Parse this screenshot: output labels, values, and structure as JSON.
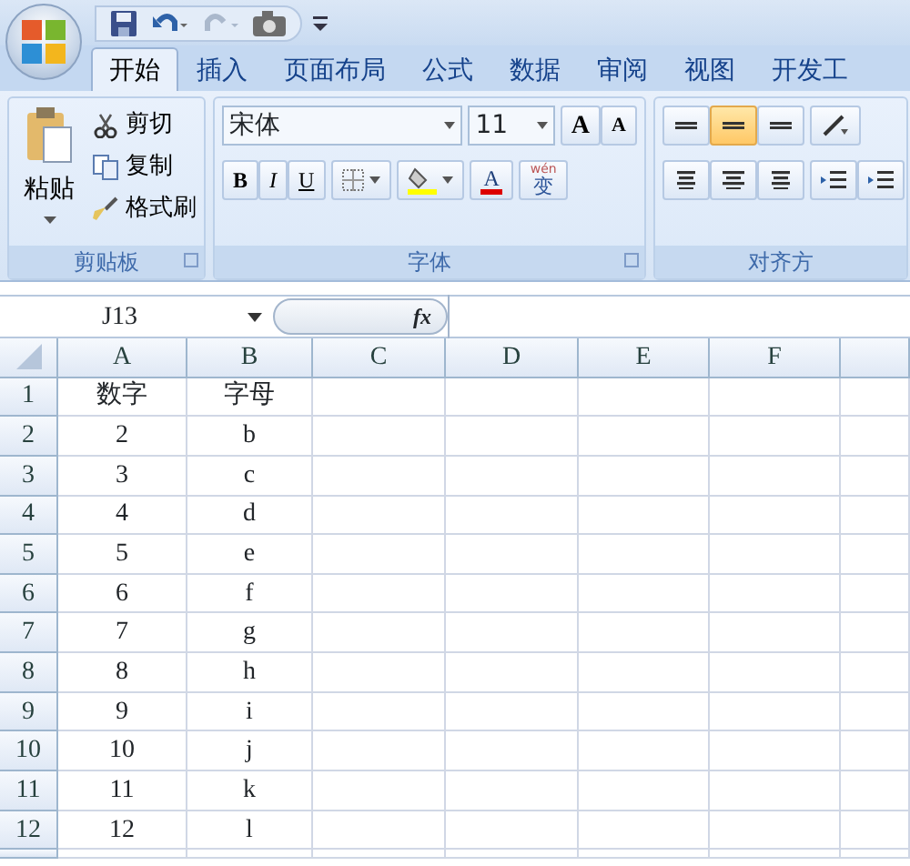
{
  "tabs": [
    {
      "label": "开始",
      "selected": true
    },
    {
      "label": "插入",
      "selected": false
    },
    {
      "label": "页面布局",
      "selected": false
    },
    {
      "label": "公式",
      "selected": false
    },
    {
      "label": "数据",
      "selected": false
    },
    {
      "label": "审阅",
      "selected": false
    },
    {
      "label": "视图",
      "selected": false
    },
    {
      "label": "开发工",
      "selected": false
    }
  ],
  "clipboard": {
    "paste": "粘贴",
    "cut": "剪切",
    "copy": "复制",
    "format_painter": "格式刷",
    "label": "剪贴板"
  },
  "font": {
    "name": "宋体",
    "size": "11",
    "grow": "A",
    "shrink": "A",
    "bold": "B",
    "italic": "I",
    "underline": "U",
    "font_color": "A",
    "phonetic_top": "wén",
    "phonetic": "变",
    "label": "字体"
  },
  "alignment": {
    "vertical": [
      {
        "selected": false
      },
      {
        "selected": true
      },
      {
        "selected": false
      }
    ],
    "label": "对齐方"
  },
  "formula_bar": {
    "name_box": "J13",
    "fx": "fx"
  },
  "sheet": {
    "columns": [
      "A",
      "B",
      "C",
      "D",
      "E",
      "F"
    ],
    "rows": [
      {
        "header": "1",
        "cells": [
          "数字",
          "字母"
        ]
      },
      {
        "header": "2",
        "cells": [
          "2",
          "b"
        ]
      },
      {
        "header": "3",
        "cells": [
          "3",
          "c"
        ]
      },
      {
        "header": "4",
        "cells": [
          "4",
          "d"
        ]
      },
      {
        "header": "5",
        "cells": [
          "5",
          "e"
        ]
      },
      {
        "header": "6",
        "cells": [
          "6",
          "f"
        ]
      },
      {
        "header": "7",
        "cells": [
          "7",
          "g"
        ]
      },
      {
        "header": "8",
        "cells": [
          "8",
          "h"
        ]
      },
      {
        "header": "9",
        "cells": [
          "9",
          "i"
        ]
      },
      {
        "header": "10",
        "cells": [
          "10",
          "j"
        ]
      },
      {
        "header": "11",
        "cells": [
          "11",
          "k"
        ]
      },
      {
        "header": "12",
        "cells": [
          "12",
          "l"
        ]
      }
    ]
  }
}
